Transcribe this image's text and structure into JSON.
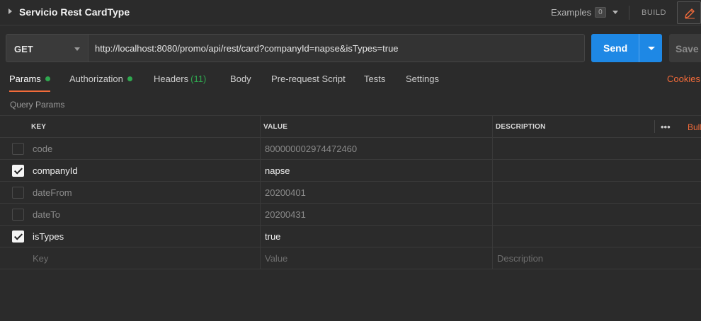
{
  "request": {
    "title": "Servicio Rest CardType",
    "examples_label": "Examples",
    "examples_count": "0",
    "build_label": "BUILD"
  },
  "url_bar": {
    "method": "GET",
    "url": "http://localhost:8080/promo/api/rest/card?companyId=napse&isTypes=true",
    "send_label": "Send",
    "save_label": "Save"
  },
  "tabs": [
    {
      "label": "Params",
      "active": true,
      "dot": true
    },
    {
      "label": "Authorization",
      "dot": true
    },
    {
      "label": "Headers",
      "count": "(11)"
    },
    {
      "label": "Body"
    },
    {
      "label": "Pre-request Script"
    },
    {
      "label": "Tests"
    },
    {
      "label": "Settings"
    }
  ],
  "cookies_label": "Cookies",
  "query_params": {
    "title": "Query Params",
    "headers": {
      "key": "KEY",
      "value": "VALUE",
      "description": "DESCRIPTION",
      "more": "•••",
      "bulk": "Bulk Edit"
    },
    "rows": [
      {
        "key": "code",
        "value": "800000002974472460",
        "description": "",
        "enabled": false
      },
      {
        "key": "companyId",
        "value": "napse",
        "description": "",
        "enabled": true
      },
      {
        "key": "dateFrom",
        "value": "20200401",
        "description": "",
        "enabled": false
      },
      {
        "key": "dateTo",
        "value": "20200431",
        "description": "",
        "enabled": false
      },
      {
        "key": "isTypes",
        "value": "true",
        "description": "",
        "enabled": true
      }
    ],
    "placeholders": {
      "key": "Key",
      "value": "Value",
      "description": "Description"
    }
  },
  "colors": {
    "accent": "#f26b3a",
    "send": "#1e88e5",
    "status_dot": "#2fa84f"
  },
  "icons": {
    "collapse": "caret-right-icon",
    "edit": "pencil-icon"
  }
}
